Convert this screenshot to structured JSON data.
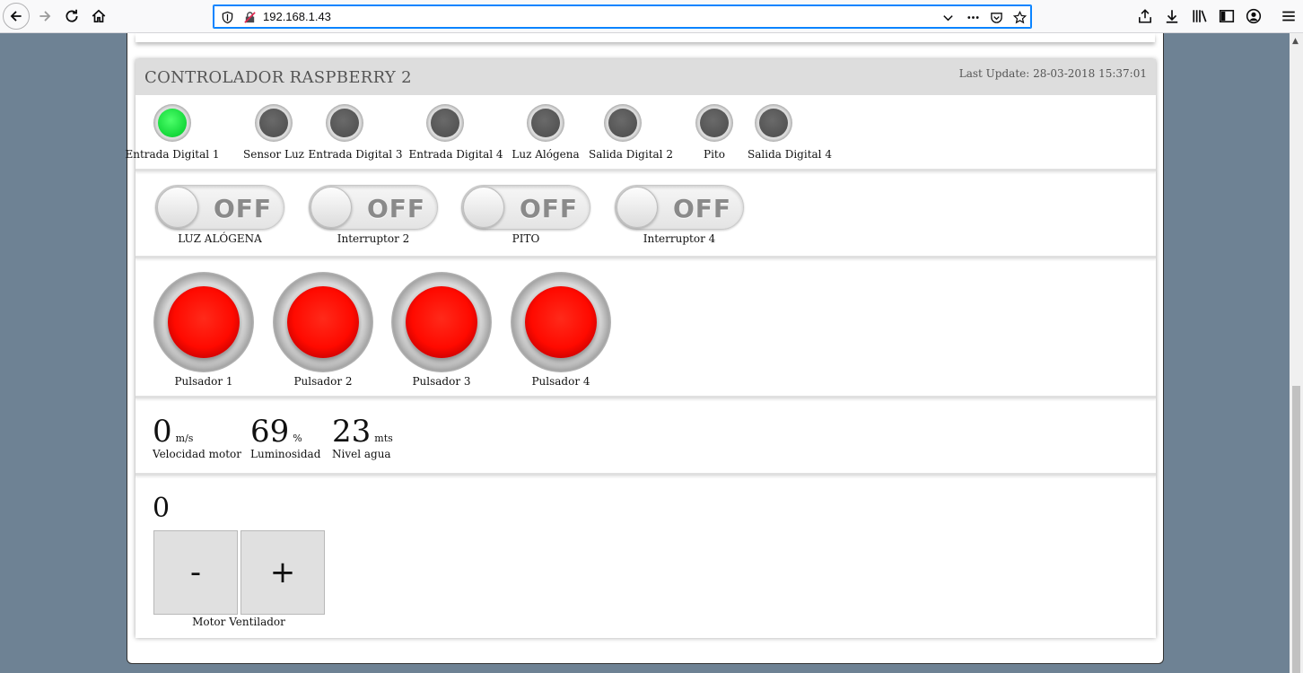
{
  "browser": {
    "url": "192.168.1.43"
  },
  "card": {
    "title": "CONTROLADOR RASPBERRY 2",
    "last_update": "Last Update: 28-03-2018 15:37:01"
  },
  "leds": [
    {
      "label": "Entrada Digital 1",
      "state": "on",
      "color": "#14d83a"
    },
    {
      "label": "Sensor Luz",
      "state": "off",
      "color": "#545454"
    },
    {
      "label": "Entrada Digital 3",
      "state": "off",
      "color": "#545454"
    },
    {
      "label": "Entrada Digital 4",
      "state": "off",
      "color": "#545454"
    },
    {
      "label": "Luz Alógena",
      "state": "off",
      "color": "#545454"
    },
    {
      "label": "Salida Digital 2",
      "state": "off",
      "color": "#545454"
    },
    {
      "label": "Pito",
      "state": "off",
      "color": "#545454"
    },
    {
      "label": "Salida Digital 4",
      "state": "off",
      "color": "#545454"
    }
  ],
  "switches": [
    {
      "label": "LUZ ALÓGENA",
      "state_text": "OFF"
    },
    {
      "label": "Interruptor 2",
      "state_text": "OFF"
    },
    {
      "label": "PITO",
      "state_text": "OFF"
    },
    {
      "label": "Interruptor 4",
      "state_text": "OFF"
    }
  ],
  "push_buttons": [
    {
      "label": "Pulsador 1",
      "color": "#ff0a00"
    },
    {
      "label": "Pulsador 2",
      "color": "#ff0a00"
    },
    {
      "label": "Pulsador 3",
      "color": "#ff0a00"
    },
    {
      "label": "Pulsador 4",
      "color": "#ff0a00"
    }
  ],
  "sensors": [
    {
      "value": "0",
      "unit": "m/s",
      "label": "Velocidad motor"
    },
    {
      "value": "69",
      "unit": "%",
      "label": "Luminosidad"
    },
    {
      "value": "23",
      "unit": "mts",
      "label": "Nivel agua"
    }
  ],
  "motor": {
    "value": "0",
    "minus_label": "-",
    "plus_label": "+",
    "label": "Motor Ventilador"
  }
}
